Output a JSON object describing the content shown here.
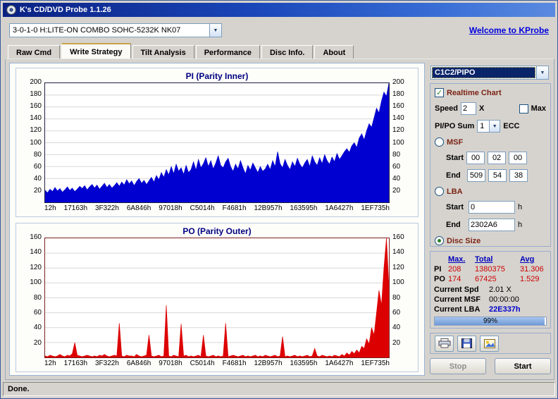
{
  "window": {
    "title": "K's CD/DVD Probe 1.1.26",
    "status": "Done."
  },
  "toolbar": {
    "drive": "3-0-1-0 H:LITE-ON COMBO SOHC-5232K NK07",
    "welcome_link": "Welcome to KProbe"
  },
  "tabs": [
    {
      "label": "Raw Cmd"
    },
    {
      "label": "Write Strategy"
    },
    {
      "label": "Tilt Analysis"
    },
    {
      "label": "Performance"
    },
    {
      "label": "Disc Info."
    },
    {
      "label": "About"
    }
  ],
  "sidebar": {
    "mode_select": "C1C2/PIPO",
    "realtime_label": "Realtime Chart",
    "speed": {
      "label": "Speed",
      "value": "2",
      "unit": "X",
      "max_label": "Max"
    },
    "pipo_sum": {
      "label": "PI/PO Sum",
      "value": "1",
      "suffix": "ECC"
    },
    "msf": {
      "label": "MSF",
      "start_label": "Start",
      "end_label": "End",
      "start": [
        "00",
        "02",
        "00"
      ],
      "end": [
        "509",
        "54",
        "38"
      ]
    },
    "lba": {
      "label": "LBA",
      "start_label": "Start",
      "end_label": "End",
      "start": "0",
      "end": "2302A6",
      "unit": "h"
    },
    "disc_size_label": "Disc Size",
    "stats": {
      "headers": [
        "Max.",
        "Total",
        "Avg"
      ],
      "rows": [
        {
          "label": "PI",
          "max": "208",
          "total": "1380375",
          "avg": "31.306"
        },
        {
          "label": "PO",
          "max": "174",
          "total": "67425",
          "avg": "1.529"
        }
      ]
    },
    "current": [
      {
        "label": "Current Spd",
        "value": "2.01 X"
      },
      {
        "label": "Current MSF",
        "value": "00:00:00"
      },
      {
        "label": "Current LBA",
        "value": "22E337h"
      }
    ],
    "progress": {
      "percent": 99,
      "label": "99%"
    },
    "buttons": {
      "stop": "Stop",
      "start": "Start"
    }
  },
  "chart_data": [
    {
      "type": "area",
      "title": "PI (Parity Inner)",
      "color": "#0000d0",
      "frame": "#202040",
      "ylim": [
        0,
        200
      ],
      "ystep": 20,
      "xlabels": [
        "12h",
        "17163h",
        "3F322h",
        "6A846h",
        "97018h",
        "C5014h",
        "F4681h",
        "12B957h",
        "163595h",
        "1A6427h",
        "1EF735h"
      ],
      "values": [
        20,
        16,
        22,
        18,
        25,
        19,
        23,
        17,
        21,
        26,
        20,
        24,
        18,
        22,
        27,
        23,
        28,
        21,
        26,
        30,
        24,
        29,
        22,
        27,
        32,
        25,
        30,
        24,
        28,
        33,
        27,
        34,
        29,
        38,
        31,
        36,
        28,
        35,
        40,
        32,
        37,
        30,
        36,
        42,
        34,
        45,
        38,
        50,
        42,
        55,
        46,
        60,
        48,
        64,
        52,
        58,
        47,
        62,
        50,
        55,
        68,
        54,
        72,
        58,
        65,
        75,
        60,
        70,
        56,
        66,
        78,
        62,
        58,
        68,
        74,
        60,
        52,
        64,
        56,
        70,
        58,
        48,
        62,
        54,
        66,
        58,
        50,
        60,
        52,
        56,
        64,
        55,
        70,
        60,
        85,
        65,
        58,
        72,
        62,
        55,
        68,
        60,
        74,
        64,
        58,
        66,
        72,
        60,
        78,
        68,
        62,
        75,
        65,
        80,
        70,
        64,
        76,
        68,
        82,
        72,
        78,
        85,
        90,
        84,
        95,
        100,
        92,
        108,
        115,
        105,
        120,
        132,
        126,
        142,
        158,
        150,
        170,
        185,
        178,
        200
      ]
    },
    {
      "type": "area",
      "title": "PO (Parity Outer)",
      "color": "#dd0000",
      "frame": "#7a2020",
      "ylim": [
        0,
        160
      ],
      "ystep": 20,
      "xlabels": [
        "12h",
        "17163h",
        "3F322h",
        "6A846h",
        "97018h",
        "C5014h",
        "F4681h",
        "12B957h",
        "163595h",
        "1A6427h",
        "1EF735h"
      ],
      "values": [
        2,
        1,
        3,
        2,
        1,
        2,
        4,
        2,
        1,
        3,
        2,
        5,
        20,
        3,
        2,
        1,
        2,
        3,
        2,
        1,
        2,
        1,
        3,
        2,
        4,
        2,
        1,
        2,
        3,
        2,
        46,
        2,
        1,
        3,
        2,
        2,
        1,
        4,
        2,
        1,
        2,
        3,
        30,
        2,
        1,
        2,
        3,
        1,
        2,
        70,
        2,
        1,
        3,
        2,
        1,
        45,
        2,
        3,
        1,
        2,
        1,
        2,
        3,
        1,
        30,
        2,
        1,
        2,
        3,
        1,
        2,
        1,
        2,
        46,
        1,
        2,
        3,
        2,
        1,
        2,
        3,
        1,
        2,
        1,
        2,
        3,
        1,
        2,
        1,
        3,
        2,
        1,
        2,
        3,
        1,
        2,
        28,
        1,
        2,
        1,
        2,
        3,
        1,
        2,
        1,
        2,
        3,
        1,
        2,
        12,
        2,
        1,
        3,
        2,
        1,
        2,
        1,
        3,
        2,
        1,
        4,
        2,
        6,
        3,
        8,
        5,
        10,
        6,
        15,
        12,
        25,
        18,
        40,
        30,
        60,
        90,
        70,
        120,
        160,
        95
      ]
    }
  ]
}
